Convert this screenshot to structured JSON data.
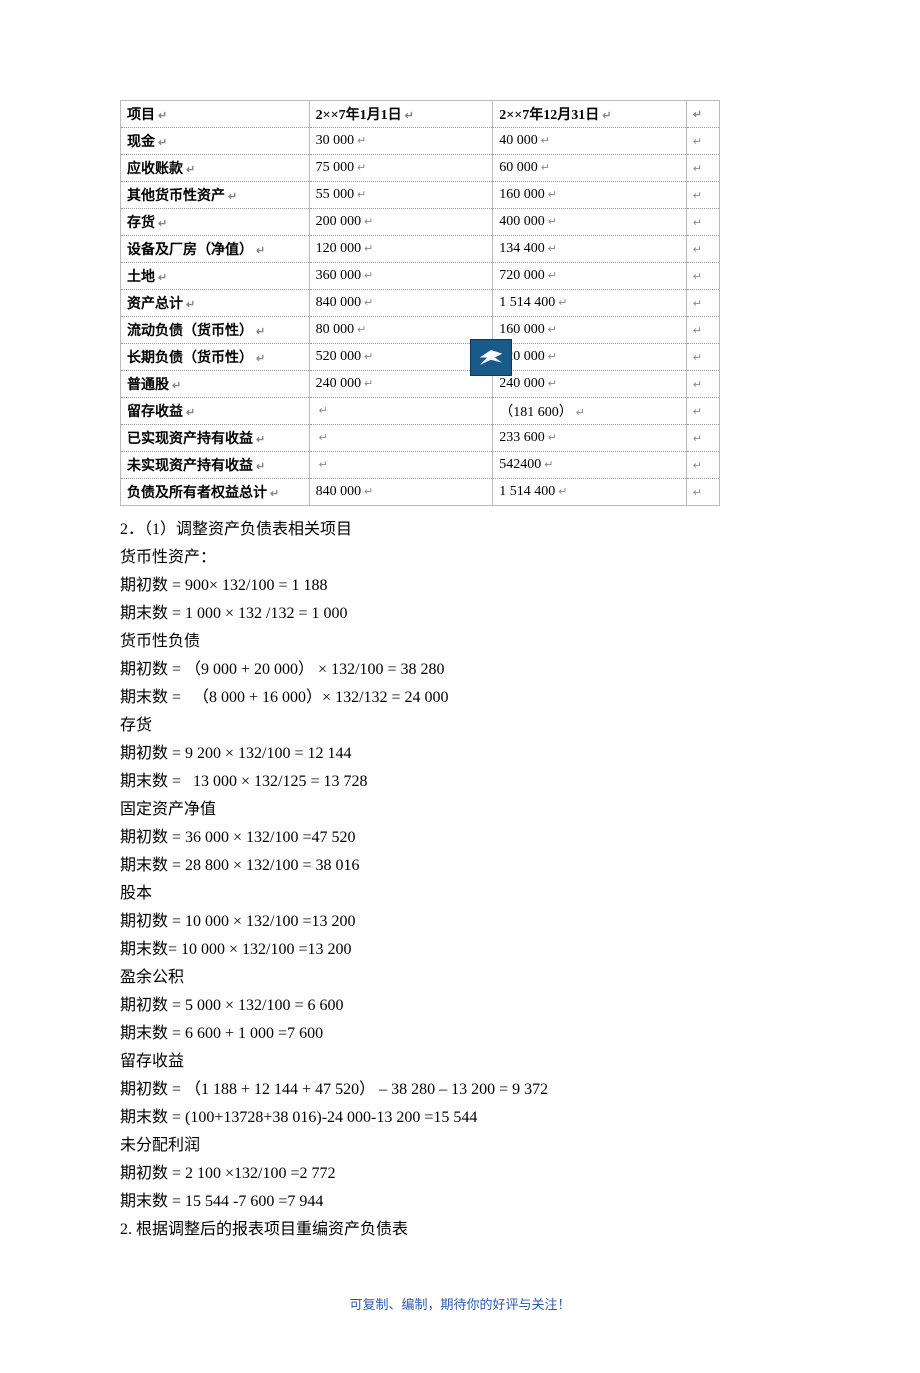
{
  "table": {
    "headers": [
      "项目",
      "2××7年1月1日",
      "2××7年12月31日"
    ],
    "rows": [
      {
        "label": "现金",
        "a": "30 000",
        "b": "40 000"
      },
      {
        "label": "应收账款",
        "a": "75 000",
        "b": "60 000"
      },
      {
        "label": "其他货币性资产",
        "a": "55 000",
        "b": "160 000"
      },
      {
        "label": "存货",
        "a": "200 000",
        "b": "400 000"
      },
      {
        "label": "设备及厂房（净值）",
        "a": "120 000",
        "b": "134 400"
      },
      {
        "label": "土地",
        "a": "360 000",
        "b": "720 000"
      },
      {
        "label": "资产总计",
        "a": "840 000",
        "b": "1 514 400"
      },
      {
        "label": "流动负债（货币性）",
        "a": "80 000",
        "b": "160 000"
      },
      {
        "label": "长期负债（货币性）",
        "a": "520 000",
        "b": "520 000",
        "watermark": true
      },
      {
        "label": "普通股",
        "a": "240 000",
        "b": "240 000"
      },
      {
        "label": "留存收益",
        "a": "",
        "b": "（181 600）"
      },
      {
        "label": "已实现资产持有收益",
        "a": "",
        "b": "233 600"
      },
      {
        "label": "未实现资产持有收益",
        "a": "",
        "b": "542400"
      },
      {
        "label": "负债及所有者权益总计",
        "a": "840 000",
        "b": "1 514 400"
      }
    ]
  },
  "body_lines": [
    "2．（1）调整资产负债表相关项目",
    "货币性资产：",
    "期初数 = 900× 132/100 = 1 188",
    "期末数 = 1 000 × 132 /132 = 1 000",
    "货币性负债",
    "期初数 = （9 000 + 20 000） × 132/100 = 38 280",
    "期末数 =   （8 000 + 16 000）× 132/132 = 24 000",
    "存货",
    "期初数 = 9 200 × 132/100 = 12 144",
    "期末数 =   13 000 × 132/125 = 13 728",
    "固定资产净值",
    "期初数 = 36 000 × 132/100 =47 520",
    "期末数 = 28 800 × 132/100 = 38 016",
    "股本",
    "期初数 = 10 000 × 132/100 =13 200",
    "期末数= 10 000 × 132/100 =13 200",
    "盈余公积",
    "期初数 = 5 000 × 132/100 = 6 600",
    "期末数 = 6 600 + 1 000 =7 600",
    "留存收益",
    "期初数 = （1 188 + 12 144 + 47 520） – 38 280 – 13 200 = 9 372",
    "期末数 = (100+13728+38 016)-24 000-13 200 =15 544",
    "未分配利润",
    "期初数 = 2 100 ×132/100 =2 772",
    "期末数 = 15 544 -7 600 =7 944",
    "2. 根据调整后的报表项目重编资产负债表"
  ],
  "footer": "可复制、编制，期待你的好评与关注！",
  "return_mark": "↵"
}
